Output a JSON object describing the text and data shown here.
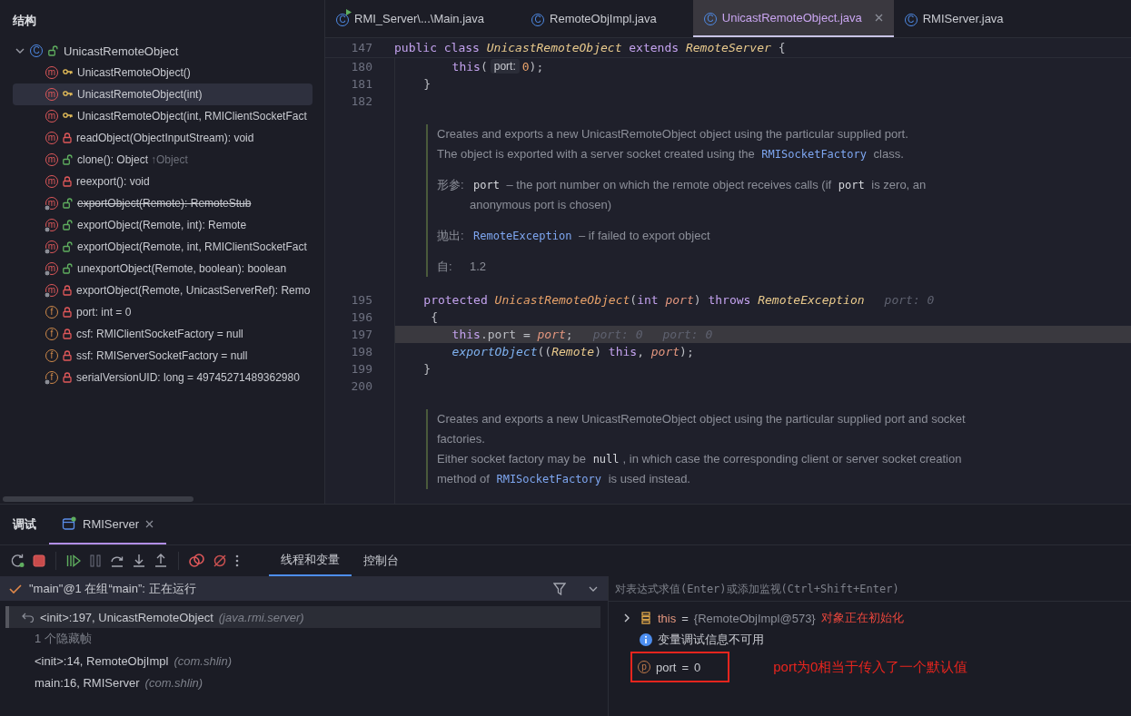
{
  "structure": {
    "title": "结构",
    "root": {
      "name": "UnicastRemoteObject",
      "kind": "class",
      "icon_letter": "C",
      "access": {
        "kind": "public"
      },
      "expanded": true,
      "children": [
        {
          "name": "UnicastRemoteObject()",
          "kind": "method",
          "icon_letter": "m",
          "access": {
            "kind": "protected"
          },
          "static": false,
          "deprecated": false,
          "selected": false
        },
        {
          "name": "UnicastRemoteObject(int)",
          "kind": "method",
          "icon_letter": "m",
          "access": {
            "kind": "protected"
          },
          "static": false,
          "deprecated": false,
          "selected": true
        },
        {
          "name": "UnicastRemoteObject(int, RMIClientSocketFact",
          "kind": "method",
          "icon_letter": "m",
          "access": {
            "kind": "protected"
          },
          "static": false,
          "deprecated": false,
          "selected": false
        },
        {
          "name": "readObject(ObjectInputStream): void",
          "kind": "method",
          "icon_letter": "m",
          "access": {
            "kind": "private"
          },
          "static": false,
          "deprecated": false,
          "selected": false
        },
        {
          "name": "clone(): Object",
          "suffix": "↑Object",
          "kind": "method",
          "icon_letter": "m",
          "access": {
            "kind": "public"
          },
          "static": false,
          "deprecated": false,
          "selected": false
        },
        {
          "name": "reexport(): void",
          "kind": "method",
          "icon_letter": "m",
          "access": {
            "kind": "private"
          },
          "static": false,
          "deprecated": false,
          "selected": false
        },
        {
          "name": "exportObject(Remote): RemoteStub",
          "kind": "method",
          "icon_letter": "m",
          "access": {
            "kind": "public"
          },
          "static": true,
          "deprecated": true,
          "selected": false
        },
        {
          "name": "exportObject(Remote, int): Remote",
          "kind": "method",
          "icon_letter": "m",
          "access": {
            "kind": "public"
          },
          "static": true,
          "deprecated": false,
          "selected": false
        },
        {
          "name": "exportObject(Remote, int, RMIClientSocketFact",
          "kind": "method",
          "icon_letter": "m",
          "access": {
            "kind": "public"
          },
          "static": true,
          "deprecated": false,
          "selected": false
        },
        {
          "name": "unexportObject(Remote, boolean): boolean",
          "kind": "method",
          "icon_letter": "m",
          "access": {
            "kind": "public"
          },
          "static": true,
          "deprecated": false,
          "selected": false
        },
        {
          "name": "exportObject(Remote, UnicastServerRef): Remo",
          "kind": "method",
          "icon_letter": "m",
          "access": {
            "kind": "private"
          },
          "static": true,
          "deprecated": false,
          "selected": false
        },
        {
          "name": "port: int = 0",
          "kind": "field",
          "icon_letter": "f",
          "access": {
            "kind": "private"
          },
          "static": false,
          "deprecated": false,
          "selected": false
        },
        {
          "name": "csf: RMIClientSocketFactory = null",
          "kind": "field",
          "icon_letter": "f",
          "access": {
            "kind": "private"
          },
          "static": false,
          "deprecated": false,
          "selected": false
        },
        {
          "name": "ssf: RMIServerSocketFactory = null",
          "kind": "field",
          "icon_letter": "f",
          "access": {
            "kind": "private"
          },
          "static": false,
          "deprecated": false,
          "selected": false
        },
        {
          "name": "serialVersionUID: long = 49745271489362980",
          "kind": "field",
          "icon_letter": "f",
          "access": {
            "kind": "private"
          },
          "static": true,
          "deprecated": false,
          "selected": false
        }
      ]
    }
  },
  "editor": {
    "tabs": [
      {
        "label": "RMI_Server\\...\\Main.java",
        "icon_letter": "C",
        "runnable": true,
        "selected": false
      },
      {
        "label": "RemoteObjImpl.java",
        "icon_letter": "C",
        "runnable": false,
        "selected": false
      },
      {
        "label": "UnicastRemoteObject.java",
        "icon_letter": "C",
        "runnable": false,
        "selected": true
      },
      {
        "label": "RMIServer.java",
        "icon_letter": "C",
        "runnable": false,
        "selected": false
      }
    ],
    "sticky_line": {
      "number": "147",
      "tokens": [
        {
          "kind": "kw",
          "text": "public class "
        },
        {
          "kind": "type",
          "text": "UnicastRemoteObject"
        },
        {
          "kind": "kw",
          "text": " extends "
        },
        {
          "kind": "type",
          "text": "RemoteServer"
        },
        {
          "kind": "plain",
          "text": " {"
        }
      ]
    },
    "blocks": [
      {
        "kind": "code",
        "number": "180",
        "current": false,
        "tokens": [
          {
            "kind": "kw",
            "text": "        this"
          },
          {
            "kind": "plain",
            "text": "("
          },
          {
            "kind": "inlay",
            "text": "port:"
          },
          {
            "kind": "num",
            "text": "0"
          },
          {
            "kind": "plain",
            "text": ");"
          }
        ]
      },
      {
        "kind": "code",
        "number": "181",
        "current": false,
        "tokens": [
          {
            "kind": "plain",
            "text": "    }"
          }
        ]
      },
      {
        "kind": "code",
        "number": "182",
        "current": false
      },
      {
        "kind": "doc",
        "paragraphs": [
          {
            "segments": [
              {
                "kind": "text",
                "text": "Creates and exports a new UnicastRemoteObject object using the particular supplied port."
              }
            ]
          },
          {
            "segments": [
              {
                "kind": "text",
                "text": "The object is exported with a server socket created using the "
              },
              {
                "kind": "link",
                "text": "RMISocketFactory"
              },
              {
                "kind": "text",
                "text": " class."
              }
            ]
          },
          {
            "label": "形参:",
            "segments": [
              {
                "kind": "code",
                "text": "port"
              },
              {
                "kind": "text",
                "text": " – the port number on which the remote object receives calls (if "
              },
              {
                "kind": "code",
                "text": "port"
              },
              {
                "kind": "text",
                "text": " is zero, an anonymous port is chosen)"
              }
            ]
          },
          {
            "label": "抛出:",
            "segments": [
              {
                "kind": "link",
                "text": "RemoteException"
              },
              {
                "kind": "text",
                "text": " – if failed to export object"
              }
            ]
          },
          {
            "label": "自:",
            "segments": [
              {
                "kind": "text",
                "text": "1.2"
              }
            ]
          }
        ]
      },
      {
        "kind": "code",
        "number": "195",
        "current": false,
        "tokens": [
          {
            "kind": "kw",
            "text": "    protected "
          },
          {
            "kind": "ctor",
            "text": "UnicastRemoteObject"
          },
          {
            "kind": "plain",
            "text": "("
          },
          {
            "kind": "kw",
            "text": "int "
          },
          {
            "kind": "param",
            "text": "port"
          },
          {
            "kind": "plain",
            "text": ") "
          },
          {
            "kind": "kw",
            "text": "throws "
          },
          {
            "kind": "type",
            "text": "RemoteException"
          },
          {
            "kind": "hint",
            "text": "port: 0"
          }
        ]
      },
      {
        "kind": "code",
        "number": "196",
        "current": false,
        "tokens": [
          {
            "kind": "plain",
            "text": "     {"
          }
        ]
      },
      {
        "kind": "code",
        "number": "197",
        "current": true,
        "tokens": [
          {
            "kind": "kw",
            "text": "        this"
          },
          {
            "kind": "plain",
            "text": ".port = "
          },
          {
            "kind": "param",
            "text": "port"
          },
          {
            "kind": "plain",
            "text": ";"
          },
          {
            "kind": "hint",
            "text": "port: 0"
          },
          {
            "kind": "hint",
            "text": "port: 0"
          }
        ]
      },
      {
        "kind": "code",
        "number": "198",
        "current": false,
        "tokens": [
          {
            "kind": "fn",
            "text": "        exportObject"
          },
          {
            "kind": "plain",
            "text": "(("
          },
          {
            "kind": "type",
            "text": "Remote"
          },
          {
            "kind": "plain",
            "text": ") "
          },
          {
            "kind": "kw",
            "text": "this"
          },
          {
            "kind": "plain",
            "text": ", "
          },
          {
            "kind": "param",
            "text": "port"
          },
          {
            "kind": "plain",
            "text": ");"
          }
        ]
      },
      {
        "kind": "code",
        "number": "199",
        "current": false,
        "tokens": [
          {
            "kind": "plain",
            "text": "    }"
          }
        ]
      },
      {
        "kind": "code",
        "number": "200",
        "current": false
      },
      {
        "kind": "doc",
        "paragraphs": [
          {
            "segments": [
              {
                "kind": "text",
                "text": "Creates and exports a new UnicastRemoteObject object using the particular supplied port and socket factories."
              }
            ]
          },
          {
            "segments": [
              {
                "kind": "text",
                "text": "Either socket factory may be "
              },
              {
                "kind": "code",
                "text": "null"
              },
              {
                "kind": "text",
                "text": ", in which case the corresponding client or server socket creation method of "
              },
              {
                "kind": "link",
                "text": "RMISocketFactory"
              },
              {
                "kind": "text",
                "text": " is used instead."
              }
            ]
          }
        ]
      }
    ]
  },
  "debug": {
    "title": "调试",
    "session_tab": {
      "label": "RMIServer",
      "selected": true
    },
    "view_tabs": [
      {
        "label": "线程和变量",
        "selected": true
      },
      {
        "label": "控制台",
        "selected": false
      }
    ],
    "thread": {
      "text": "\"main\"@1 在组“main”: 正在运行"
    },
    "frames": [
      {
        "kind": "frame",
        "method": "<init>:197, UnicastRemoteObject",
        "package": "(java.rmi.server)",
        "selected": true
      },
      {
        "kind": "hidden",
        "text": "1 个隐藏帧"
      },
      {
        "kind": "frame",
        "method": "<init>:14, RemoteObjImpl",
        "package": "(com.shlin)",
        "selected": false
      },
      {
        "kind": "frame",
        "method": "main:16, RMIServer",
        "package": "(com.shlin)",
        "selected": false
      }
    ],
    "evaluate": {
      "placeholder": "对表达式求值(Enter)或添加监视(Ctrl+Shift+Enter)"
    },
    "variables": [
      {
        "kind": "object",
        "name": "this",
        "op": "=",
        "value": "{RemoteObjImpl@573}",
        "note": "对象正在初始化",
        "expanded": false
      },
      {
        "kind": "info",
        "text": "变量调试信息不可用"
      },
      {
        "kind": "param",
        "icon_letter": "p",
        "name": "port",
        "op": "=",
        "value": "0",
        "boxed": true
      }
    ],
    "annotation": "port为0相当于传入了一个默认值"
  }
}
